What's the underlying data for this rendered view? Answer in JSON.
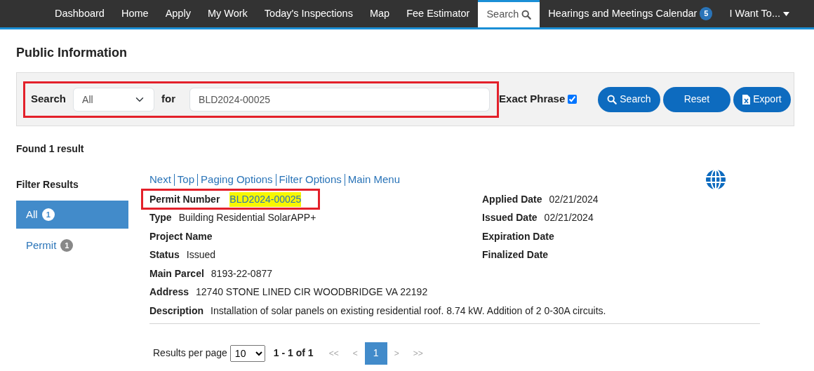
{
  "nav": [
    {
      "label": "Dashboard",
      "selected": false
    },
    {
      "label": "Home",
      "selected": false
    },
    {
      "label": "Apply",
      "selected": false
    },
    {
      "label": "My Work",
      "selected": false
    },
    {
      "label": "Today's Inspections",
      "selected": false
    },
    {
      "label": "Map",
      "selected": false
    },
    {
      "label": "Fee Estimator",
      "selected": false
    },
    {
      "label": "Search",
      "selected": true,
      "kind": "search"
    },
    {
      "label": "Hearings and Meetings Calendar",
      "selected": false,
      "badge": "5"
    },
    {
      "label": "I Want To...",
      "selected": false,
      "kind": "dropdown"
    }
  ],
  "page_title": "Public Information",
  "search": {
    "label": "Search",
    "scope": "All",
    "for_label": "for",
    "value": "BLD2024-00025",
    "highlighted": true,
    "exact_phrase": {
      "label": "Exact Phrase",
      "checked": true
    },
    "buttons": [
      {
        "label": "Search",
        "kind": "search"
      },
      {
        "label": "Reset",
        "kind": "plain"
      },
      {
        "label": "Export",
        "kind": "export"
      }
    ]
  },
  "result_count": "Found 1 result",
  "filter": {
    "title": "Filter Results",
    "items": [
      {
        "label": "All",
        "count": "1",
        "selected": true
      },
      {
        "label": "Permit",
        "count": "1",
        "selected": false
      }
    ]
  },
  "result_links": [
    "Next",
    "Top",
    "Paging Options",
    "Filter Options",
    "Main Menu"
  ],
  "left_fields": [
    {
      "label": "Permit Number",
      "value": "BLD2024-00025",
      "highlighted": true
    },
    {
      "label": "Type",
      "value": "Building Residential SolarAPP+",
      "highlighted": false
    },
    {
      "label": "Project Name",
      "highlighted": false
    },
    {
      "label": "Status",
      "value": "Issued",
      "highlighted": false
    }
  ],
  "right_fields": [
    {
      "label": "Applied Date",
      "value": "02/21/2024"
    },
    {
      "label": "Issued Date",
      "value": "02/21/2024"
    },
    {
      "label": "Expiration Date"
    },
    {
      "label": "Finalized Date"
    }
  ],
  "full_fields": [
    {
      "label": "Main Parcel",
      "value": "8193-22-0877"
    },
    {
      "label": "Address",
      "value": "12740 STONE LINED CIR WOODBRIDGE VA 22192"
    },
    {
      "label": "Description",
      "value": "Installation of solar panels on existing residential roof. 8.74 kW. Addition of 2 0-30A circuits."
    }
  ],
  "pagination": {
    "label": "Results per page",
    "per_page": "10",
    "range": "1 - 1 of 1",
    "first": "<<",
    "prev": "<",
    "pages": [
      {
        "label": "1",
        "selected": true
      }
    ],
    "next": ">",
    "last": ">>"
  }
}
